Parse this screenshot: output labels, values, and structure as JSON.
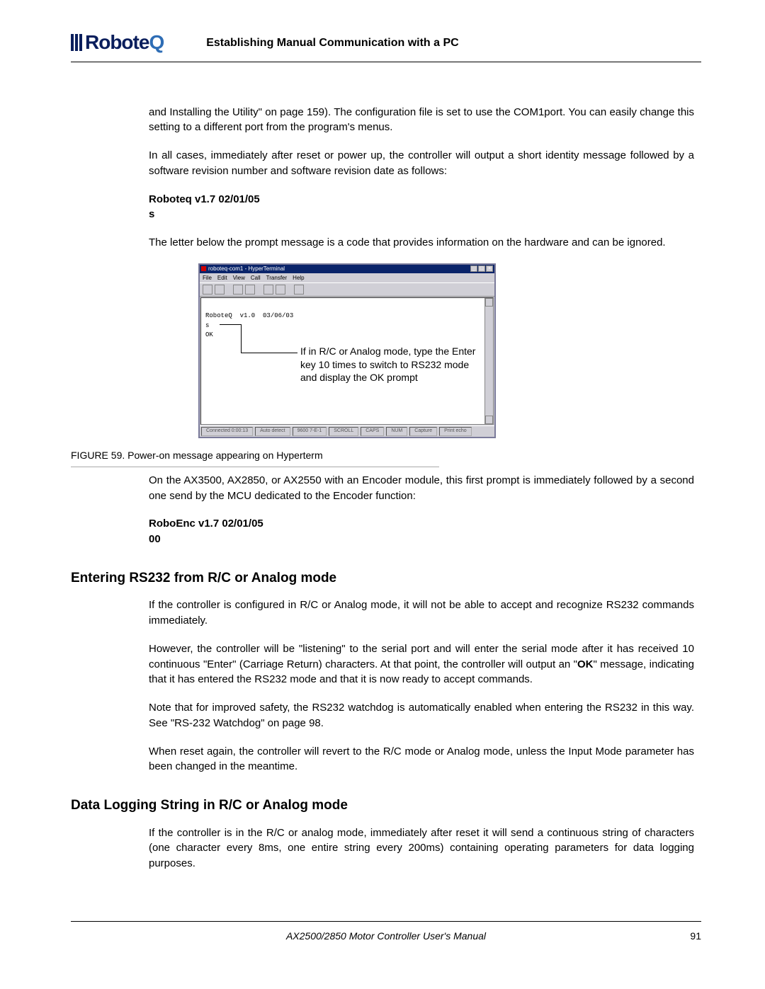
{
  "header": {
    "logo_part1": "Robote",
    "logo_part2": "Q",
    "title": "Establishing Manual Communication with a PC"
  },
  "content": {
    "p1": "and Installing the Utility\" on page 159). The configuration file is set to use the COM1port. You can easily change this setting to a different port from the program's menus.",
    "p2": "In all cases, immediately after reset or power up, the controller will output a short identity message followed by a software revision number and software revision date as follows:",
    "code1_line1": "Roboteq v1.7 02/01/05",
    "code1_line2": "s",
    "p3": "The letter below the prompt message is a code that provides information on the hardware and can be ignored.",
    "p4": "On the AX3500, AX2850, or AX2550 with an Encoder module, this first prompt is immediately followed by a second one send by the MCU dedicated to the Encoder function:",
    "code2_line1": "RoboEnc v1.7 02/01/05",
    "code2_line2": "00",
    "h1": "Entering RS232 from R/C or Analog mode",
    "p5": "If the controller is configured in R/C or Analog mode, it will not be able to accept and recognize RS232 commands immediately.",
    "p6a": "However, the controller will be \"listening\" to the serial port and will enter the serial mode after it has received 10 continuous \"Enter\" (Carriage Return) characters. At that point, the controller will output an \"",
    "p6b": "OK",
    "p6c": "\" message, indicating that it has entered the RS232 mode and that it is now ready to accept commands.",
    "p7": "Note that for improved safety, the RS232 watchdog is automatically enabled when entering the RS232 in this way. See \"RS-232 Watchdog\" on page 98.",
    "p8": "When reset again, the controller will revert to the R/C mode or Analog mode, unless the Input Mode parameter has been changed in the meantime.",
    "h2": "Data Logging String in R/C or Analog mode",
    "p9": "If the controller is in the R/C or analog mode, immediately after reset it will send a continuous string of characters (one character every 8ms, one entire string every 200ms) containing operating parameters for data logging purposes."
  },
  "figure": {
    "title": "roboteq-com1 - HyperTerminal",
    "menu": [
      "File",
      "Edit",
      "View",
      "Call",
      "Transfer",
      "Help"
    ],
    "terminal_line1": "RoboteQ  v1.0  03/06/03",
    "terminal_line2": "s",
    "terminal_line3": "OK",
    "callout": "If in R/C or Analog mode, type the Enter key 10 times to switch to RS232 mode and display the OK prompt",
    "status": {
      "s1": "Connected 0:00:13",
      "s2": "Auto detect",
      "s3": "9600 7-E-1",
      "s4": "SCROLL",
      "s5": "CAPS",
      "s6": "NUM",
      "s7": "Capture",
      "s8": "Print echo"
    },
    "caption": "FIGURE 59.  Power-on message appearing on Hyperterm"
  },
  "footer": {
    "center": "AX2500/2850 Motor Controller User's Manual",
    "page": "91"
  }
}
